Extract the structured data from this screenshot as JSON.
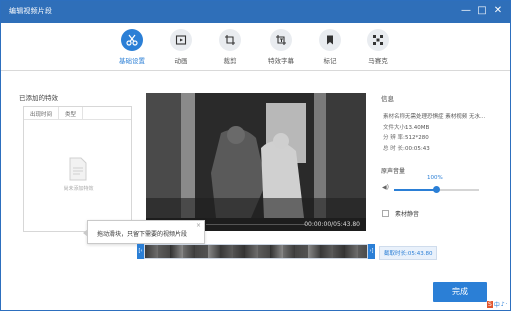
{
  "window": {
    "title": "编辑视频片段",
    "controls": [
      "minimize-icon",
      "maximize-icon",
      "close-icon"
    ]
  },
  "toolbar": {
    "tools": [
      {
        "label": "基础设置",
        "icon": "scissors-icon",
        "active": true
      },
      {
        "label": "动画",
        "icon": "play-square-icon",
        "active": false
      },
      {
        "label": "裁剪",
        "icon": "crop-icon",
        "active": false
      },
      {
        "label": "特效字幕",
        "icon": "text-crop-icon",
        "active": false
      },
      {
        "label": "标记",
        "icon": "bookmark-icon",
        "active": false
      },
      {
        "label": "马赛克",
        "icon": "mosaic-icon",
        "active": false
      }
    ]
  },
  "effects": {
    "title": "已添加的特效",
    "columns": [
      "出现时间",
      "类型"
    ],
    "empty_text": "尚未添加特效"
  },
  "player": {
    "time": "00:00:00/05:43.80"
  },
  "tooltip": {
    "text": "拖动滑块，只留下需要的视频片段",
    "close": "×"
  },
  "timeline": {
    "cut_duration": "截取时长:05:43.80",
    "left_handle": "[‹",
    "right_handle": "›]"
  },
  "info": {
    "title": "信息",
    "rows": [
      {
        "key": "素材名称:",
        "value": "无需处理恐惧症 素材视频 无水..."
      },
      {
        "key": "文件大小:",
        "value": "13.40MB"
      },
      {
        "key": "分 辨 率:",
        "value": "512*280"
      },
      {
        "key": "总 时 长:",
        "value": "00:05:43"
      }
    ]
  },
  "volume": {
    "title": "原声音量",
    "percent": "100%",
    "level": 0.5,
    "icon": "speaker-icon"
  },
  "mute": {
    "label": "素材静音",
    "checked": false
  },
  "finish_button": "完成",
  "tray": {
    "items": [
      "S",
      "中",
      "♪",
      "·"
    ]
  },
  "colors": {
    "accent": "#2b7fd6",
    "titlebar": "#2f6fb9"
  }
}
